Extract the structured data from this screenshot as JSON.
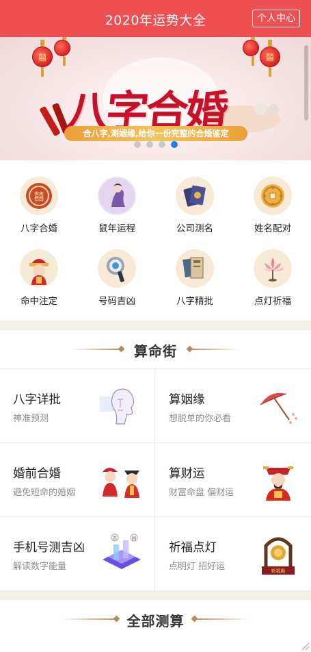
{
  "header": {
    "title": "2020年运势大全",
    "user_center_label": "个人中心",
    "accent_color": "#ee5052"
  },
  "banner": {
    "headline": "八字合婚",
    "ribbon": "合八字,测姻缘,给你一份完整的合婚鉴定",
    "lantern_glyph": "囍",
    "slide_count": 4,
    "active_slide": 4
  },
  "categories": [
    {
      "label": "八字合婚",
      "icon": "double-happiness-icon"
    },
    {
      "label": "鼠年运程",
      "icon": "rat-year-icon"
    },
    {
      "label": "公司测名",
      "icon": "company-name-icon"
    },
    {
      "label": "姓名配对",
      "icon": "coin-icon"
    },
    {
      "label": "命中注定",
      "icon": "fate-doll-icon"
    },
    {
      "label": "号码吉凶",
      "icon": "magnifier-icon"
    },
    {
      "label": "八字精批",
      "icon": "book-icon"
    },
    {
      "label": "点灯祈福",
      "icon": "lotus-lamp-icon"
    }
  ],
  "sections": {
    "street_title": "算命街",
    "all_title": "全部测算"
  },
  "street_cards": [
    {
      "title": "八字详批",
      "subtitle": "神准预测",
      "icon": "face-sketch-icon"
    },
    {
      "title": "算姻缘",
      "subtitle": "想脱单的你必看",
      "icon": "umbrella-icon"
    },
    {
      "title": "婚前合婚",
      "subtitle": "避免短命的婚姻",
      "icon": "wedding-couple-icon"
    },
    {
      "title": "算财运",
      "subtitle": "财富命盘 偏财运",
      "icon": "god-of-wealth-icon"
    },
    {
      "title": "手机号测吉凶",
      "subtitle": "解读数字能量",
      "icon": "phone-number-icon"
    },
    {
      "title": "祈福点灯",
      "subtitle": "点明灯 招好运",
      "icon": "bell-shrine-icon"
    }
  ],
  "shrine_plaque": "祈福殿",
  "phone_tags": [
    "吉",
    "凶"
  ]
}
